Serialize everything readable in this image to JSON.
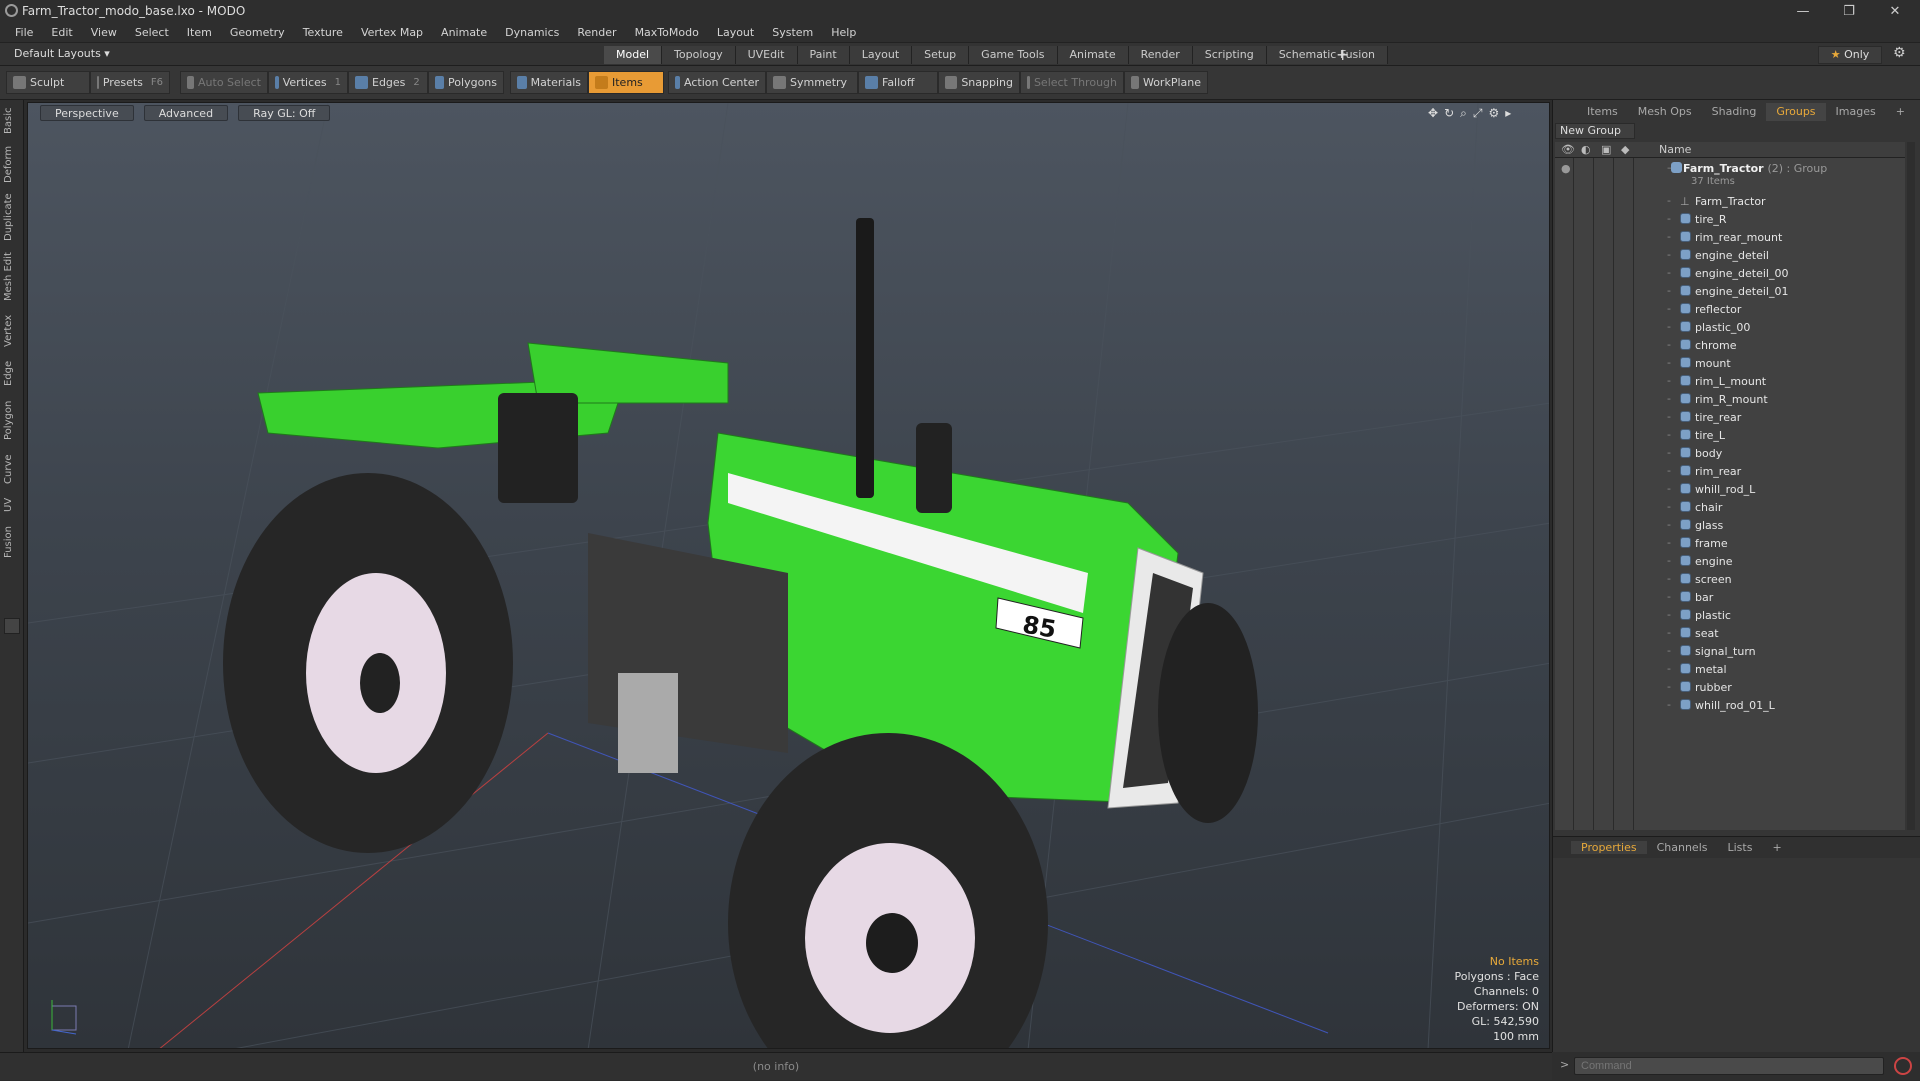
{
  "window": {
    "title": "Farm_Tractor_modo_base.lxo - MODO",
    "controls": [
      "—",
      "❐",
      "✕"
    ]
  },
  "menu": [
    "File",
    "Edit",
    "View",
    "Select",
    "Item",
    "Geometry",
    "Texture",
    "Vertex Map",
    "Animate",
    "Dynamics",
    "Render",
    "MaxToModo",
    "Layout",
    "System",
    "Help"
  ],
  "layout": {
    "selector": "Default Layouts ▾",
    "tabs": [
      "Model",
      "Topology",
      "UVEdit",
      "Paint",
      "Layout",
      "Setup",
      "Game Tools",
      "Animate",
      "Render",
      "Scripting",
      "Schematic Fusion"
    ],
    "active_tab": "Model",
    "plus": "+",
    "only_label": "Only"
  },
  "toolbar": {
    "sculpt": "Sculpt",
    "presets": "Presets",
    "presets_key": "F6",
    "auto_select": "Auto Select",
    "vertices": "Vertices",
    "vertices_key": "1",
    "edges": "Edges",
    "edges_key": "2",
    "polygons": "Polygons",
    "materials": "Materials",
    "items": "Items",
    "action_center": "Action Center",
    "symmetry": "Symmetry",
    "falloff": "Falloff",
    "snapping": "Snapping",
    "select_through": "Select Through",
    "workplane": "WorkPlane"
  },
  "left_tabs": [
    "Basic",
    "Deform",
    "Duplicate",
    "Mesh Edit",
    "Vertex",
    "Edge",
    "Polygon",
    "Curve",
    "UV",
    "Fusion"
  ],
  "viewport": {
    "buttons": [
      "Perspective",
      "Advanced",
      "Ray GL: Off"
    ],
    "model_badge": "85",
    "stats": {
      "selection": "No Items",
      "polygons": "Polygons : Face",
      "channels": "Channels: 0",
      "deformers": "Deformers: ON",
      "gl": "GL: 542,590",
      "scale": "100 mm"
    }
  },
  "right_panel": {
    "tabs": [
      "Items",
      "Mesh Ops",
      "Shading",
      "Groups",
      "Images",
      "+"
    ],
    "active_tab": "Groups",
    "new_group": "New Group",
    "col_name": "Name",
    "group": {
      "name": "Farm_Tractor",
      "type_suffix": "(2) : Group",
      "count": "37 Items"
    },
    "items": [
      "Farm_Tractor",
      "tire_R",
      "rim_rear_mount",
      "engine_deteil",
      "engine_deteil_00",
      "engine_deteil_01",
      "reflector",
      "plastic_00",
      "chrome",
      "mount",
      "rim_L_mount",
      "rim_R_mount",
      "tire_rear",
      "tire_L",
      "body",
      "rim_rear",
      "whill_rod_L",
      "chair",
      "glass",
      "frame",
      "engine",
      "screen",
      "bar",
      "plastic",
      "seat",
      "signal_turn",
      "metal",
      "rubber",
      "whill_rod_01_L"
    ]
  },
  "properties": {
    "tabs": [
      "Properties",
      "Channels",
      "Lists",
      "+"
    ],
    "active_tab": "Properties"
  },
  "status": {
    "info": "(no info)",
    "command_placeholder": "Command",
    "prompt": ">"
  },
  "colors": {
    "accent": "#e89b35",
    "tractor_green": "#33d32a",
    "panel": "#353535"
  }
}
